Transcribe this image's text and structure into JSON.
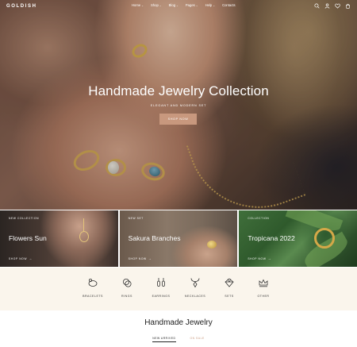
{
  "nav": {
    "logo": "GOLDISH",
    "menu": [
      {
        "label": "Home"
      },
      {
        "label": "Shop"
      },
      {
        "label": "Blog"
      },
      {
        "label": "Pages"
      },
      {
        "label": "Help"
      },
      {
        "label": "Contacts"
      }
    ],
    "icons": [
      "search-icon",
      "user-icon",
      "heart-icon",
      "cart-icon"
    ]
  },
  "hero": {
    "title": "Handmade Jewelry Collection",
    "subtitle": "ELEGANT AND MODERN SET",
    "button": "SHOP NOW"
  },
  "collections": [
    {
      "tag": "NEW COLLECTION",
      "name": "Flowers Sun",
      "link": "SHOP NOW"
    },
    {
      "tag": "NEW SET",
      "name": "Sakura Branches",
      "link": "SHOP NOW"
    },
    {
      "tag": "COLLECTION",
      "name": "Tropicana 2022",
      "link": "SHOP NOW"
    }
  ],
  "categories": [
    {
      "label": "BRACELETS",
      "icon": "bracelet-icon"
    },
    {
      "label": "RINGS",
      "icon": "rings-icon"
    },
    {
      "label": "EARRINGS",
      "icon": "earrings-icon"
    },
    {
      "label": "NECKLACES",
      "icon": "necklace-icon"
    },
    {
      "label": "SETS",
      "icon": "sets-icon"
    },
    {
      "label": "OTHER",
      "icon": "crown-icon"
    }
  ],
  "section": {
    "title": "Handmade Jewelry",
    "tabs": [
      {
        "label": "NEW ARRIVED"
      },
      {
        "label": "ON SALE"
      }
    ]
  },
  "colors": {
    "accent": "#c8987e",
    "cream": "#faf5ec"
  }
}
